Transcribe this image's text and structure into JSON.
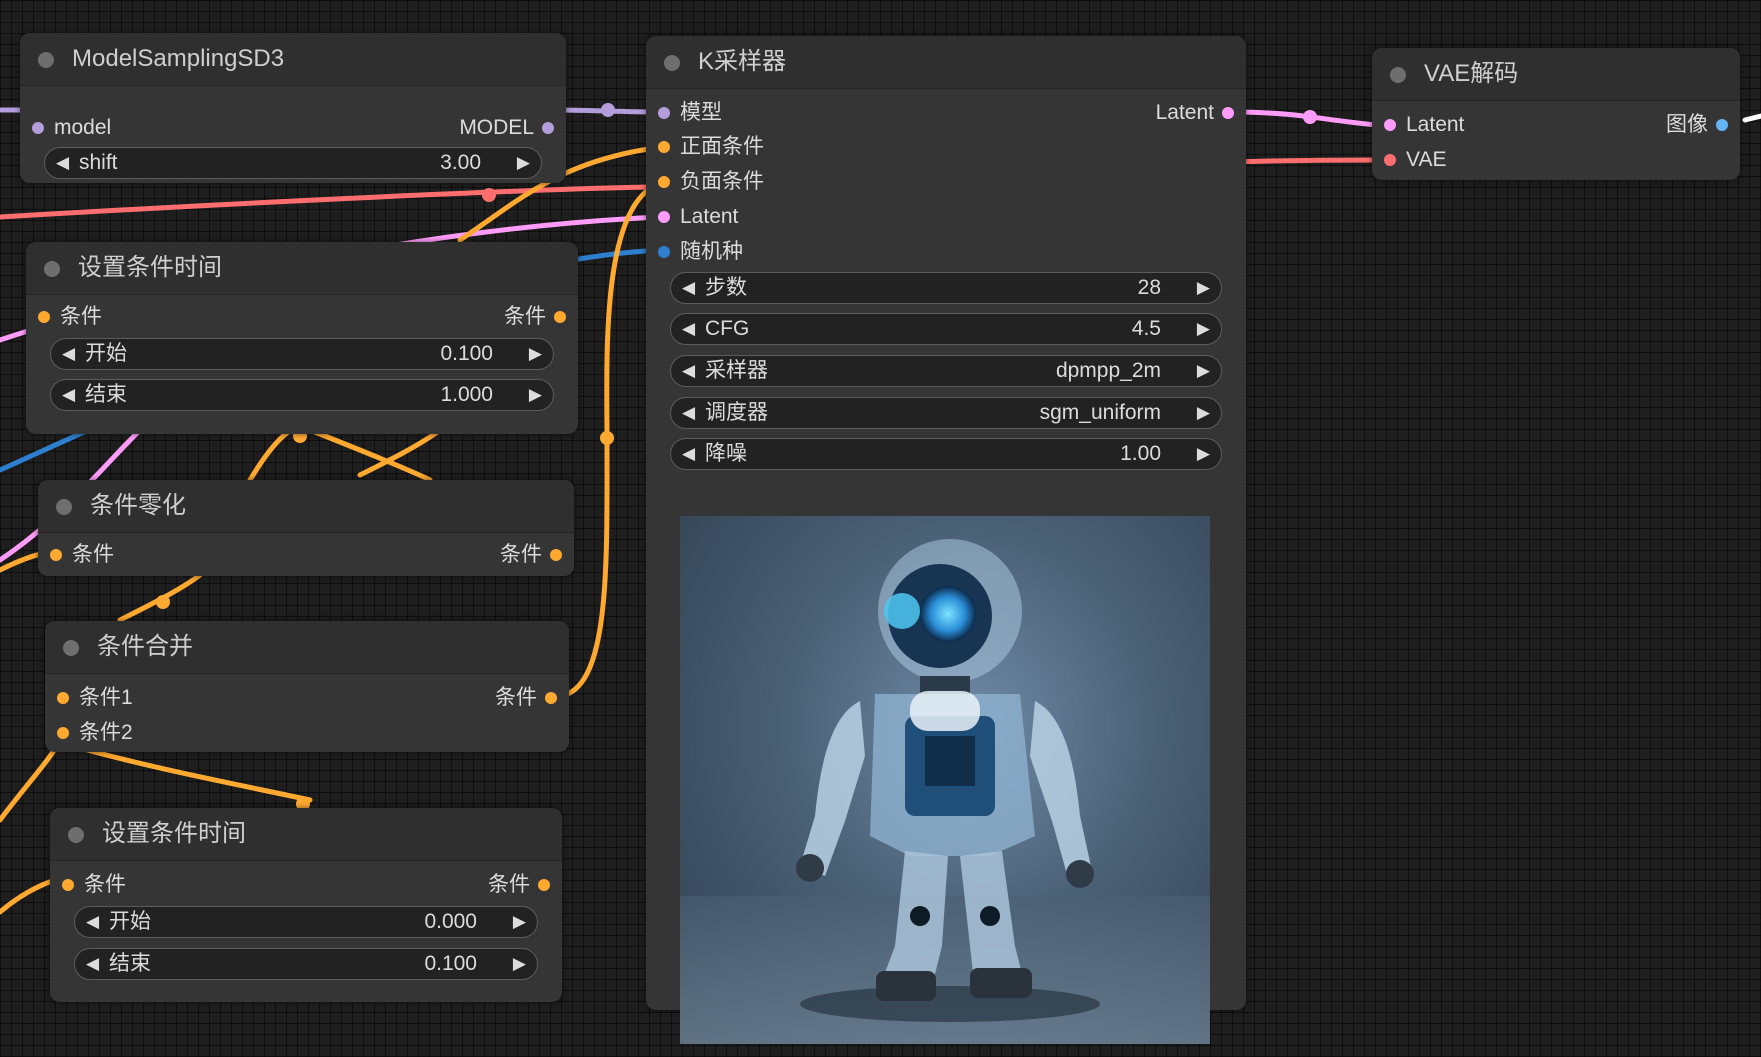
{
  "colors": {
    "model": "#b39ddb",
    "conditioning": "#ffa931",
    "vae": "#ff6e6e",
    "latent": "#ff9cf9",
    "int": "#2e7fcf",
    "image": "#64b5f6"
  },
  "nodes": {
    "model_sampling": {
      "title": "ModelSamplingSD3",
      "input_model": "model",
      "output_model": "MODEL",
      "shift": {
        "name": "shift",
        "value": "3.00"
      }
    },
    "cond_timestep_1": {
      "title": "设置条件时间",
      "input": "条件",
      "output": "条件",
      "start": {
        "name": "开始",
        "value": "0.100"
      },
      "end": {
        "name": "结束",
        "value": "1.000"
      }
    },
    "cond_zero": {
      "title": "条件零化",
      "input": "条件",
      "output": "条件"
    },
    "cond_combine": {
      "title": "条件合并",
      "input1": "条件1",
      "input2": "条件2",
      "output": "条件"
    },
    "cond_timestep_2": {
      "title": "设置条件时间",
      "input": "条件",
      "output": "条件",
      "start": {
        "name": "开始",
        "value": "0.000"
      },
      "end": {
        "name": "结束",
        "value": "0.100"
      }
    },
    "ksampler": {
      "title": "K采样器",
      "inputs": [
        "模型",
        "正面条件",
        "负面条件",
        "Latent",
        "随机种"
      ],
      "output": "Latent",
      "widgets": [
        {
          "name": "步数",
          "value": "28"
        },
        {
          "name": "CFG",
          "value": "4.5"
        },
        {
          "name": "采样器",
          "value": "dpmpp_2m"
        },
        {
          "name": "调度器",
          "value": "sgm_uniform"
        },
        {
          "name": "降噪",
          "value": "1.00"
        }
      ]
    },
    "vae_decode": {
      "title": "VAE解码",
      "input_latent": "Latent",
      "input_vae": "VAE",
      "output": "图像"
    }
  },
  "icons": {
    "decrement": "◀",
    "increment": "▶"
  }
}
